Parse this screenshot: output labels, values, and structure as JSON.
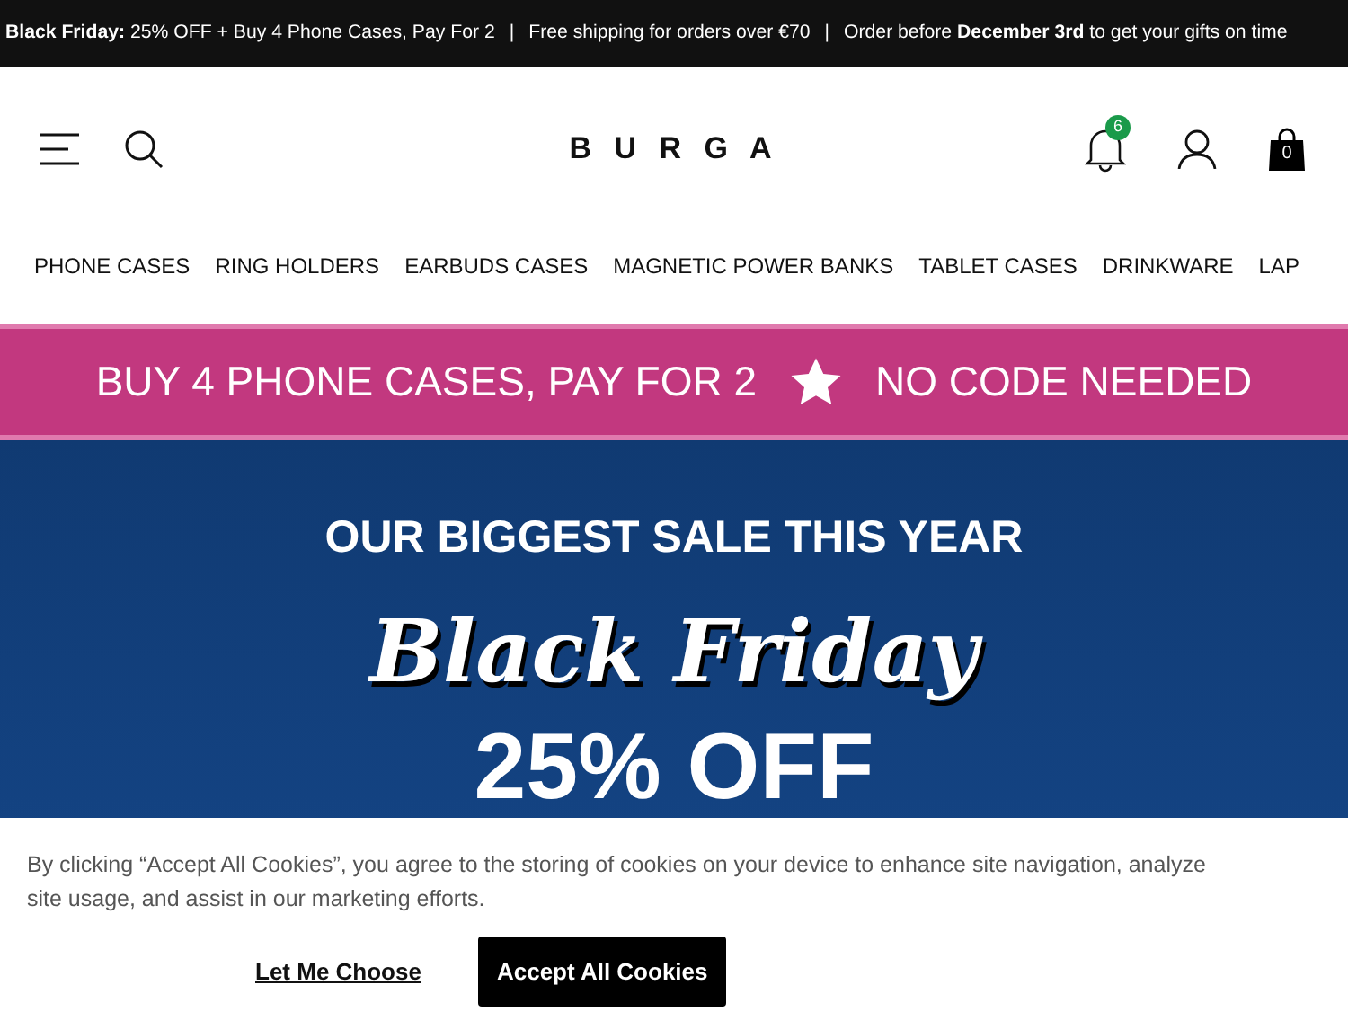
{
  "announcement": {
    "lead": "**Black Friday:** 25% OFF + Buy 4 Phone Cases, Pay For 2",
    "separator_1": "|",
    "shipping": "Free shipping for orders over €70",
    "separator_2": "|",
    "deadline": "Order before **December 3rd** to get your gifts on time"
  },
  "header": {
    "logo": "B U R G A",
    "notification_count": "6",
    "cart_count": "0"
  },
  "nav": [
    "PHONE CASES",
    "RING HOLDERS",
    "EARBUDS CASES",
    "MAGNETIC POWER BANKS",
    "TABLET CASES",
    "DRINKWARE",
    "LAP"
  ],
  "promo_bar": {
    "left": "BUY 4 PHONE CASES, PAY FOR 2",
    "right": "NO CODE NEEDED"
  },
  "hero": {
    "kicker": "OUR BIGGEST SALE THIS YEAR",
    "title": "Black Friday",
    "discount": "25% OFF"
  },
  "cookie_banner": {
    "text": "By clicking “Accept All Cookies”, you agree to the storing of cookies on your device to enhance site navigation, analyze site usage, and assist in our marketing efforts.",
    "buttons": [
      {
        "label": "Let Me Choose",
        "kind": "link"
      },
      {
        "label": "Accept All Cookies",
        "kind": "primary"
      }
    ]
  }
}
